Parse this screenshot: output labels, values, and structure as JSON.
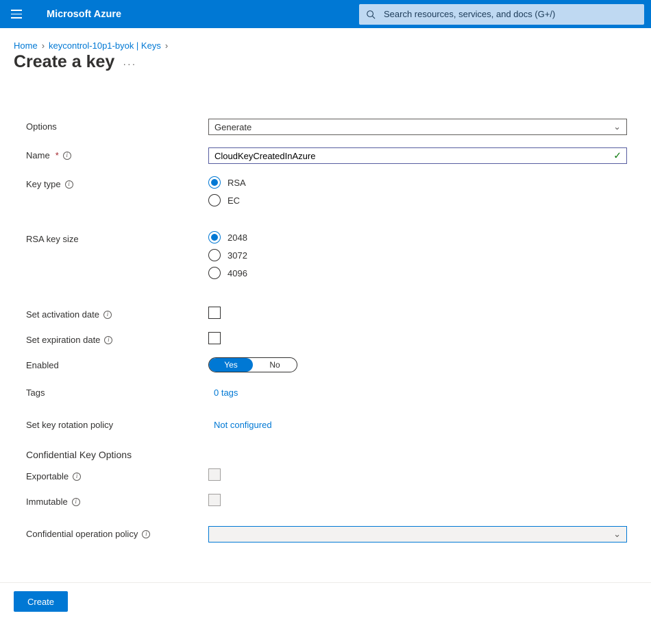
{
  "topbar": {
    "brand": "Microsoft Azure",
    "search_placeholder": "Search resources, services, and docs (G+/)"
  },
  "breadcrumbs": {
    "items": [
      {
        "label": "Home"
      },
      {
        "label": "keycontrol-10p1-byok | Keys"
      }
    ]
  },
  "page": {
    "title": "Create a key"
  },
  "form": {
    "options_label": "Options",
    "options_value": "Generate",
    "name_label": "Name",
    "name_value": "CloudKeyCreatedInAzure",
    "key_type_label": "Key type",
    "key_type_options": [
      {
        "label": "RSA",
        "checked": true
      },
      {
        "label": "EC",
        "checked": false
      }
    ],
    "rsa_size_label": "RSA key size",
    "rsa_size_options": [
      {
        "label": "2048",
        "checked": true
      },
      {
        "label": "3072",
        "checked": false
      },
      {
        "label": "4096",
        "checked": false
      }
    ],
    "activation_label": "Set activation date",
    "expiration_label": "Set expiration date",
    "enabled_label": "Enabled",
    "enabled_yes": "Yes",
    "enabled_no": "No",
    "tags_label": "Tags",
    "tags_value": "0 tags",
    "rotation_label": "Set key rotation policy",
    "rotation_value": "Not configured",
    "confidential_heading": "Confidential Key Options",
    "exportable_label": "Exportable",
    "immutable_label": "Immutable",
    "cop_label": "Confidential operation policy",
    "cop_value": ""
  },
  "footer": {
    "create_label": "Create"
  }
}
